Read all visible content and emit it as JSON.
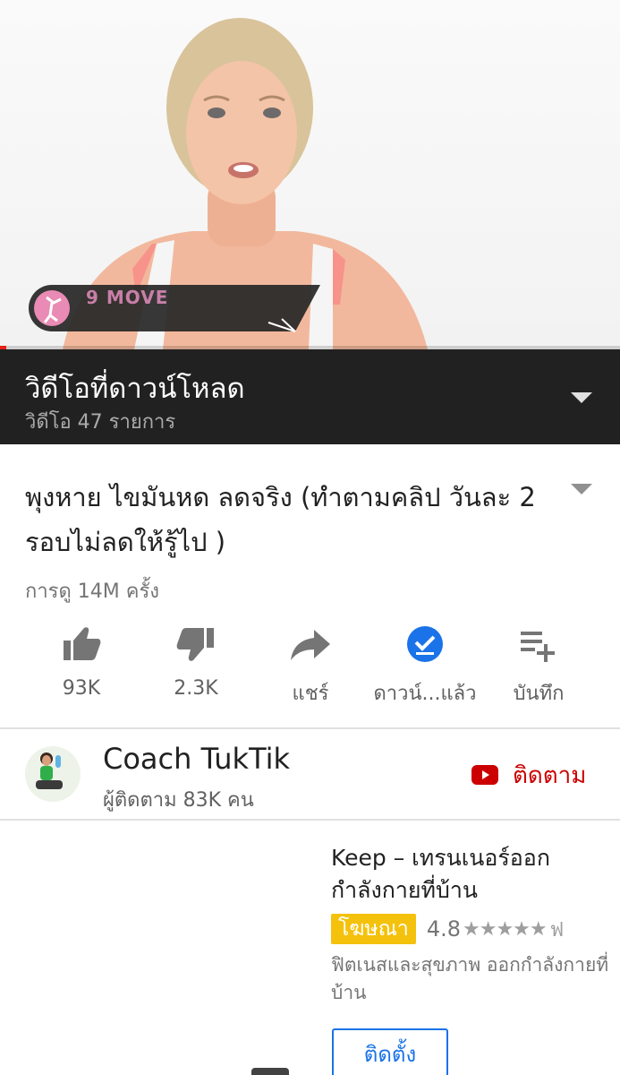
{
  "player": {
    "overlay_text": "9 MOVE",
    "progress_fraction": 0.01
  },
  "playlist": {
    "title": "วิดีโอที่ดาวน์โหลด",
    "count": "วิดีโอ 47 รายการ"
  },
  "video": {
    "title": "พุงหาย ไขมันหด ลดจริง (ทำตามคลิป วันละ 2 รอบไม่ลดให้รู้ไป )",
    "views": "การดู 14M ครั้ง"
  },
  "actions": [
    {
      "label": "93K",
      "icon": "thumbs-up-icon"
    },
    {
      "label": "2.3K",
      "icon": "thumbs-down-icon"
    },
    {
      "label": "แชร์",
      "icon": "share-icon"
    },
    {
      "label": "ดาวน์...แล้ว",
      "icon": "downloaded-check-icon"
    },
    {
      "label": "บันทึก",
      "icon": "playlist-add-icon"
    }
  ],
  "channel": {
    "name": "Coach TukTik",
    "subscribers": "ผู้ติดตาม 83K คน",
    "subscribe_label": "ติดตาม"
  },
  "ad": {
    "title": "Keep – เทรนเนอร์ออกกำลังกายที่บ้าน",
    "badge": "โฆษณา",
    "rating": "4.8",
    "stars": "★★★★★",
    "stars_trailing": "ฟ",
    "description": "ฟิตเนสและสุขภาพ ออกกำลังกายที่บ้าน",
    "install_label": "ติดตั้ง"
  },
  "colors": {
    "playlist_bg": "#212121",
    "subscribe_red": "#cc0000",
    "ad_badge": "#f4c20d",
    "install_blue": "#1a73e8",
    "downloaded_blue": "#1a73e8"
  }
}
